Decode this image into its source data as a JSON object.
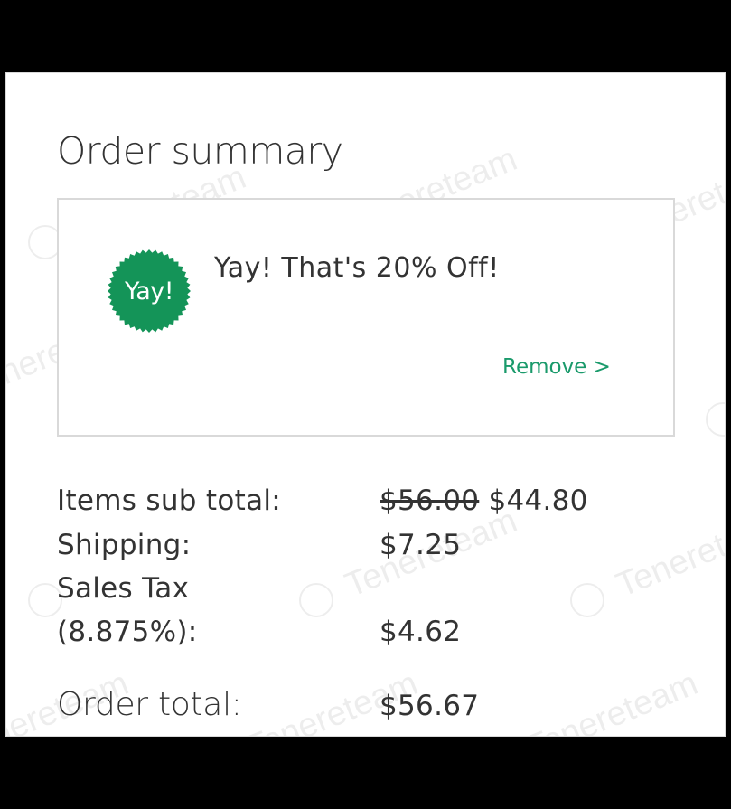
{
  "order_summary": {
    "title": "Order summary",
    "promo": {
      "badge_text": "Yay!",
      "message": "Yay! That's 20% Off!",
      "remove_label": "Remove >"
    },
    "lines": {
      "subtotal_label": "Items sub total:",
      "subtotal_original": "$56.00",
      "subtotal_discounted": "$44.80",
      "shipping_label": "Shipping:",
      "shipping_value": "$7.25",
      "tax_label_line1": "Sales Tax",
      "tax_label_line2": "(8.875%):",
      "tax_value": "$4.62",
      "total_label": "Order total:",
      "total_value": "$56.67"
    }
  },
  "watermark_text": "Tenereteam",
  "colors": {
    "badge_green": "#149458",
    "link_green": "#1a9a6b",
    "text": "#333333",
    "border": "#d9d9d9"
  },
  "icons": {
    "badge": "starburst-badge-icon"
  }
}
